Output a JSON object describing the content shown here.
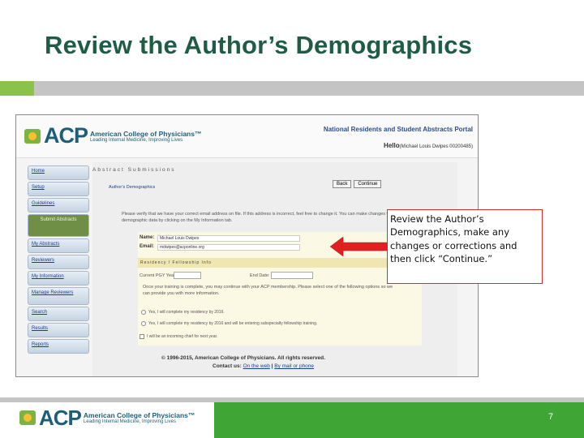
{
  "slide": {
    "title": "Review the Author’s Demographics",
    "page_number": "7"
  },
  "screenshot": {
    "logo_letters": "ACP",
    "logo_name": "American College of Physicians™",
    "logo_tagline": "Leading Internal Medicine, Improving Lives",
    "portal_title": "National Residents and Student Abstracts Portal",
    "hello_label": "Hello",
    "hello_user": "(Michael Louis Dwipes 00200485)",
    "nav": [
      "Home",
      "Setup",
      "Guidelines",
      "Submit Abstracts",
      "My Abstracts",
      "Reviewers",
      "My Information",
      "Manage Reviewers",
      "Search",
      "Results",
      "Reports"
    ],
    "section_heading": "Abstract Submissions",
    "sub_heading": "Author’s Demographics",
    "back_label": "Back",
    "continue_label": "Continue",
    "intro_text": "Please verify that we have your correct email address on file. If this address is incorrect, feel free to change it. You can make changes to your demographic data by clicking on the My Information tab.",
    "name_label": "Name:",
    "name_value": "Michael Louis Dwipes",
    "email_label": "Email:",
    "email_value": "mdwipes@acponline.org",
    "residency_bar": "Residency / Fellowship Info",
    "current_pgy_label": "Current PGY Year:",
    "end_date_label": "End Date:",
    "options_text": "Once your training is complete, you may continue with your ACP membership. Please select one of the following options so we can provide you with more information.",
    "option_1": "Yes, I will complete my residency by 2016.",
    "option_2": "Yes, I will complete my residency by 2016 and will be entering subspecialty fellowship training.",
    "option_3": "I will be an incoming chief for next year.",
    "copyright": "© 1996-2015, American College of Physicians. All rights reserved.",
    "contact_label": "Contact us:",
    "contact_web": "On the web",
    "contact_sep": " | ",
    "contact_phone": "By mail or phone"
  },
  "callout": {
    "text": "Review the Author’s Demographics, make any changes or corrections and then click “Continue.”"
  },
  "footer": {
    "logo_letters": "ACP",
    "logo_name": "American College of Physicians™",
    "logo_tagline": "Leading Internal Medicine, Improving Lives"
  },
  "colors": {
    "title_green": "#1f5c46",
    "accent_green": "#3fa535",
    "callout_border": "#d32f2f",
    "arrow_red": "#e02020"
  }
}
